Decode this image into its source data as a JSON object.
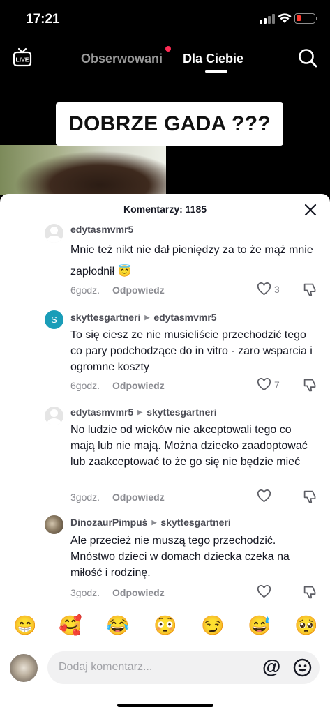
{
  "status_bar": {
    "time": "17:21"
  },
  "nav": {
    "live_label": "LIVE",
    "tab_following": "Obserwowani",
    "tab_for_you": "Dla Ciebie"
  },
  "video": {
    "caption": "DOBRZE GADA ???"
  },
  "comments_sheet": {
    "title": "Komentarzy: 1185",
    "reply_label": "Odpowiedz",
    "comments": [
      {
        "user": "edytasmvmr5",
        "reply_to": "",
        "avatar": "default",
        "text": "Mnie też nikt nie dał pieniędzy za to że mąż mnie zapłodnił 😇",
        "time": "6godz.",
        "likes": "3"
      },
      {
        "user": "skyttesgartneri",
        "reply_to": "edytasmvmr5",
        "avatar": "S",
        "text": "To się ciesz ze nie musieliście przechodzić tego co pary podchodzące do in vitro - zaro wsparcia i ogromne koszty",
        "time": "6godz.",
        "likes": "7"
      },
      {
        "user": "edytasmvmr5",
        "reply_to": "skyttesgartneri",
        "avatar": "default",
        "text": "No ludzie od wieków nie akceptowali tego co mają lub nie mają. Można dziecko zaadoptować lub zaakceptować to że go się nie będzie mieć",
        "time": "3godz.",
        "likes": ""
      },
      {
        "user": "DinozaurPimpuś",
        "reply_to": "skyttesgartneri",
        "avatar": "photo",
        "text": "Ale przecież nie muszą tego przechodzić. Mnóstwo dzieci w domach dziecka czeka na miłość i rodzinę.",
        "time": "3godz.",
        "likes": ""
      }
    ]
  },
  "emoji_bar": [
    "😁",
    "🥰",
    "😂",
    "😳",
    "😏",
    "😅",
    "🥺"
  ],
  "input": {
    "placeholder": "Dodaj komentarz...",
    "mention_symbol": "@"
  },
  "colors": {
    "accent": "#fe2c55",
    "verified_avatar": "#1a9db8"
  }
}
